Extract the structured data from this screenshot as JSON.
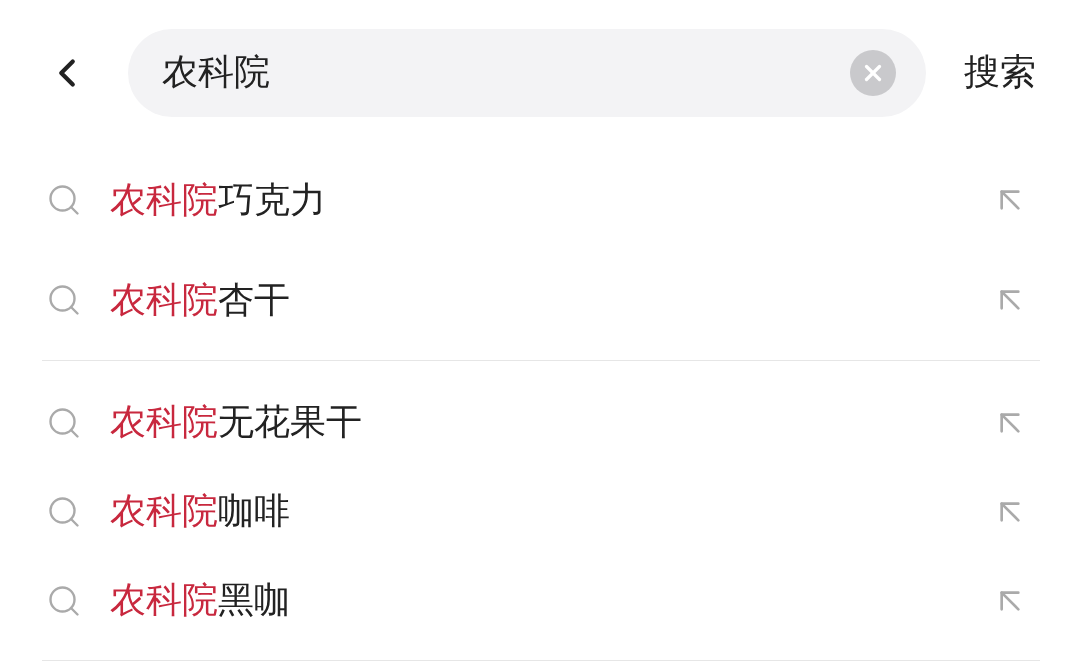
{
  "search_bar": {
    "value": "农科院",
    "submit": "搜索"
  },
  "suggestion_groups": [
    {
      "suggestions": [
        {
          "match": "农科院",
          "rest": "巧克力"
        },
        {
          "match": "农科院",
          "rest": "杏干"
        }
      ]
    },
    {
      "suggestions": [
        {
          "match": "农科院",
          "rest": "无花果干"
        },
        {
          "match": "农科院",
          "rest": "咖啡"
        },
        {
          "match": "农科院",
          "rest": "黑咖"
        }
      ]
    }
  ]
}
